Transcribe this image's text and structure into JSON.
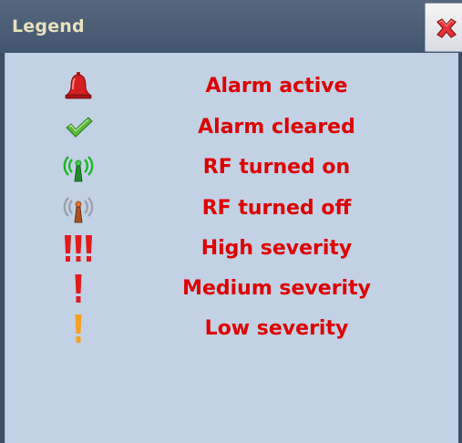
{
  "window": {
    "title": "Legend",
    "close_icon": "close-x-icon"
  },
  "colors": {
    "titlebar": "#4a5d75",
    "title_text": "#e7e2bc",
    "panel_bg": "#c3d1e4",
    "label_text": "#dd0000"
  },
  "legend": {
    "items": [
      {
        "icon": "alarm-bell-icon",
        "label": "Alarm active"
      },
      {
        "icon": "checkmark-icon",
        "label": "Alarm cleared"
      },
      {
        "icon": "rf-on-antenna-icon",
        "label": "RF turned on"
      },
      {
        "icon": "rf-off-antenna-icon",
        "label": "RF turned off"
      },
      {
        "icon": "high-severity-icon",
        "label": "High severity"
      },
      {
        "icon": "medium-severity-icon",
        "label": "Medium severity"
      },
      {
        "icon": "low-severity-icon",
        "label": "Low severity"
      }
    ]
  }
}
